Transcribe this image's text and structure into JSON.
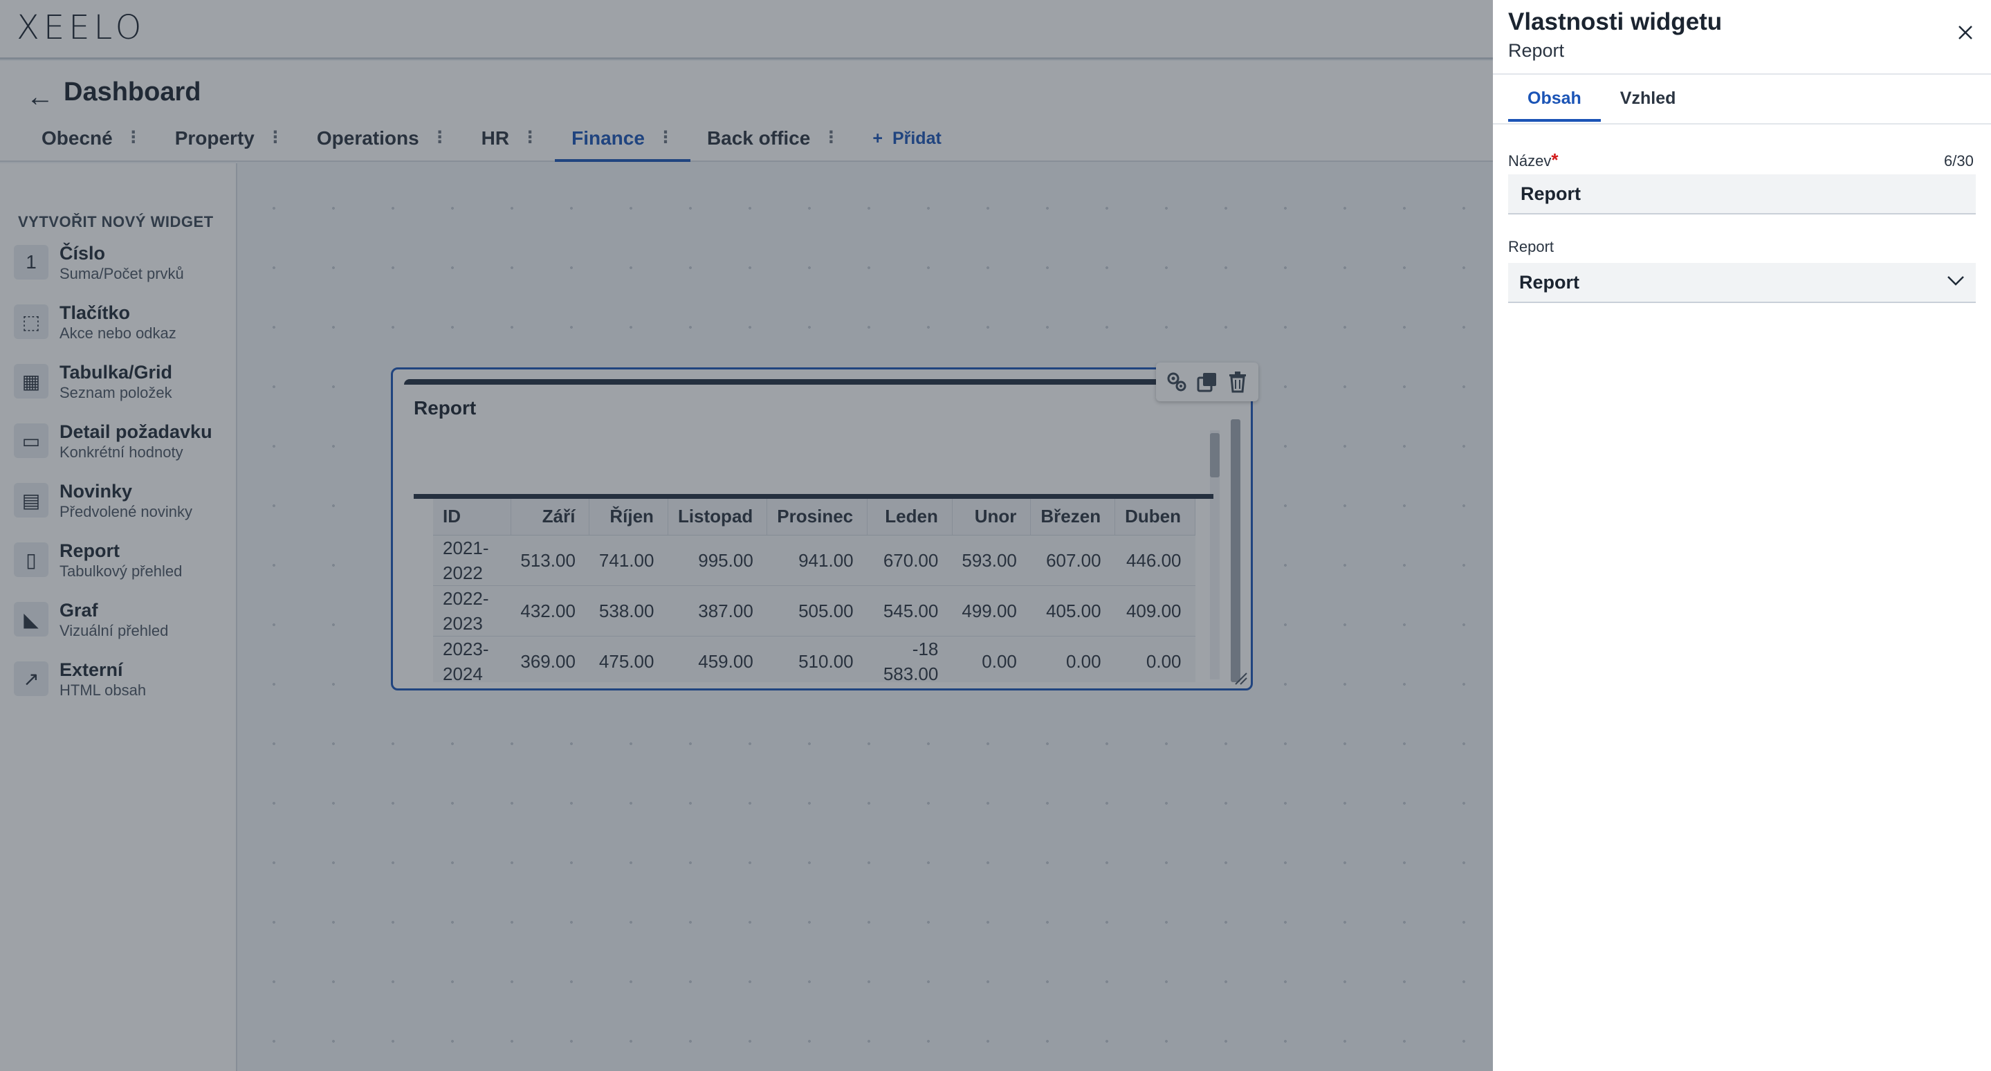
{
  "app": {
    "logo": "XEELO",
    "page_title": "Dashboard",
    "tabs": [
      {
        "label": "Obecné",
        "active": false
      },
      {
        "label": "Property",
        "active": false
      },
      {
        "label": "Operations",
        "active": false
      },
      {
        "label": "HR",
        "active": false
      },
      {
        "label": "Finance",
        "active": true
      },
      {
        "label": "Back office",
        "active": false
      }
    ],
    "add_tab_label": "Přidat"
  },
  "sidebar": {
    "heading": "VYTVOŘIT NOVÝ WIDGET",
    "items": [
      {
        "title": "Číslo",
        "subtitle": "Suma/Počet prvků",
        "icon": "number-one-icon",
        "glyph": "1"
      },
      {
        "title": "Tlačítko",
        "subtitle": "Akce nebo odkaz",
        "icon": "button-cursor-icon",
        "glyph": "⬚"
      },
      {
        "title": "Tabulka/Grid",
        "subtitle": "Seznam položek",
        "icon": "table-icon",
        "glyph": "▦"
      },
      {
        "title": "Detail požadavku",
        "subtitle": "Konkrétní hodnoty",
        "icon": "request-detail-icon",
        "glyph": "▭"
      },
      {
        "title": "Novinky",
        "subtitle": "Předvolené novinky",
        "icon": "news-icon",
        "glyph": "▤"
      },
      {
        "title": "Report",
        "subtitle": "Tabulkový přehled",
        "icon": "report-file-icon",
        "glyph": "▯"
      },
      {
        "title": "Graf",
        "subtitle": "Vizuální přehled",
        "icon": "chart-icon",
        "glyph": "◣"
      },
      {
        "title": "Externí",
        "subtitle": "HTML obsah",
        "icon": "external-link-icon",
        "glyph": "↗"
      }
    ]
  },
  "widget": {
    "title": "Report",
    "table": {
      "headers": [
        "ID",
        "Září",
        "Říjen",
        "Listopad",
        "Prosinec",
        "Leden",
        "Unor",
        "Březen",
        "Duben"
      ],
      "rows": [
        [
          "2021-2022",
          "513.00",
          "741.00",
          "995.00",
          "941.00",
          "670.00",
          "593.00",
          "607.00",
          "446.00"
        ],
        [
          "2022-2023",
          "432.00",
          "538.00",
          "387.00",
          "505.00",
          "545.00",
          "499.00",
          "405.00",
          "409.00"
        ],
        [
          "2023-2024",
          "369.00",
          "475.00",
          "459.00",
          "510.00",
          "-18 583.00",
          "0.00",
          "0.00",
          "0.00"
        ]
      ]
    }
  },
  "panel": {
    "title": "Vlastnosti widgetu",
    "subtitle": "Report",
    "tabs": [
      {
        "label": "Obsah",
        "active": true
      },
      {
        "label": "Vzhled",
        "active": false
      }
    ],
    "name_field": {
      "label": "Název",
      "required_mark": "*",
      "value": "Report",
      "counter": "6/30"
    },
    "report_field": {
      "label": "Report",
      "value": "Report"
    }
  },
  "colors": {
    "accent": "#1b54b6",
    "required": "#d31a1a",
    "overlay": "#28303c"
  }
}
